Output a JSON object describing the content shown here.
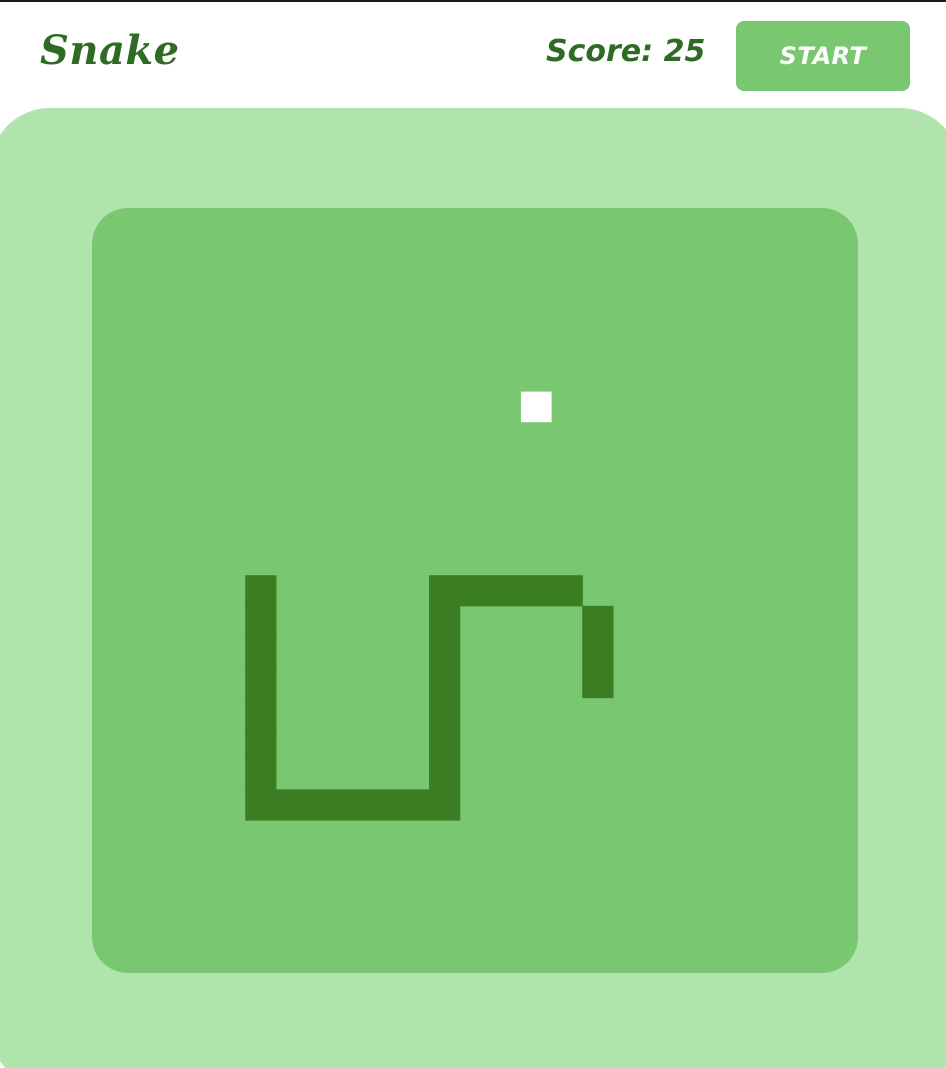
{
  "header": {
    "title": "Snake",
    "score_text": "Score: 25",
    "start_label": "START"
  },
  "game": {
    "score": 25,
    "grid": {
      "columns": 25,
      "rows": 25
    },
    "food": {
      "col": 14,
      "row": 6
    },
    "snake": [
      [
        16,
        15
      ],
      [
        16,
        14
      ],
      [
        16,
        13
      ],
      [
        15,
        12
      ],
      [
        14,
        12
      ],
      [
        13,
        12
      ],
      [
        12,
        12
      ],
      [
        11,
        12
      ],
      [
        11,
        13
      ],
      [
        11,
        14
      ],
      [
        11,
        15
      ],
      [
        11,
        16
      ],
      [
        11,
        17
      ],
      [
        11,
        18
      ],
      [
        11,
        19
      ],
      [
        10,
        19
      ],
      [
        9,
        19
      ],
      [
        8,
        19
      ],
      [
        7,
        19
      ],
      [
        6,
        19
      ],
      [
        5,
        19
      ],
      [
        5,
        18
      ],
      [
        5,
        17
      ],
      [
        5,
        16
      ],
      [
        5,
        15
      ],
      [
        5,
        14
      ],
      [
        5,
        13
      ],
      [
        5,
        12
      ]
    ]
  },
  "colors": {
    "title": "#2f6b25",
    "button": "#79c770",
    "outer_board": "#b0e4ad",
    "playfield": "#7ac771",
    "snake": "#3a7d22",
    "food": "#ffffff"
  }
}
